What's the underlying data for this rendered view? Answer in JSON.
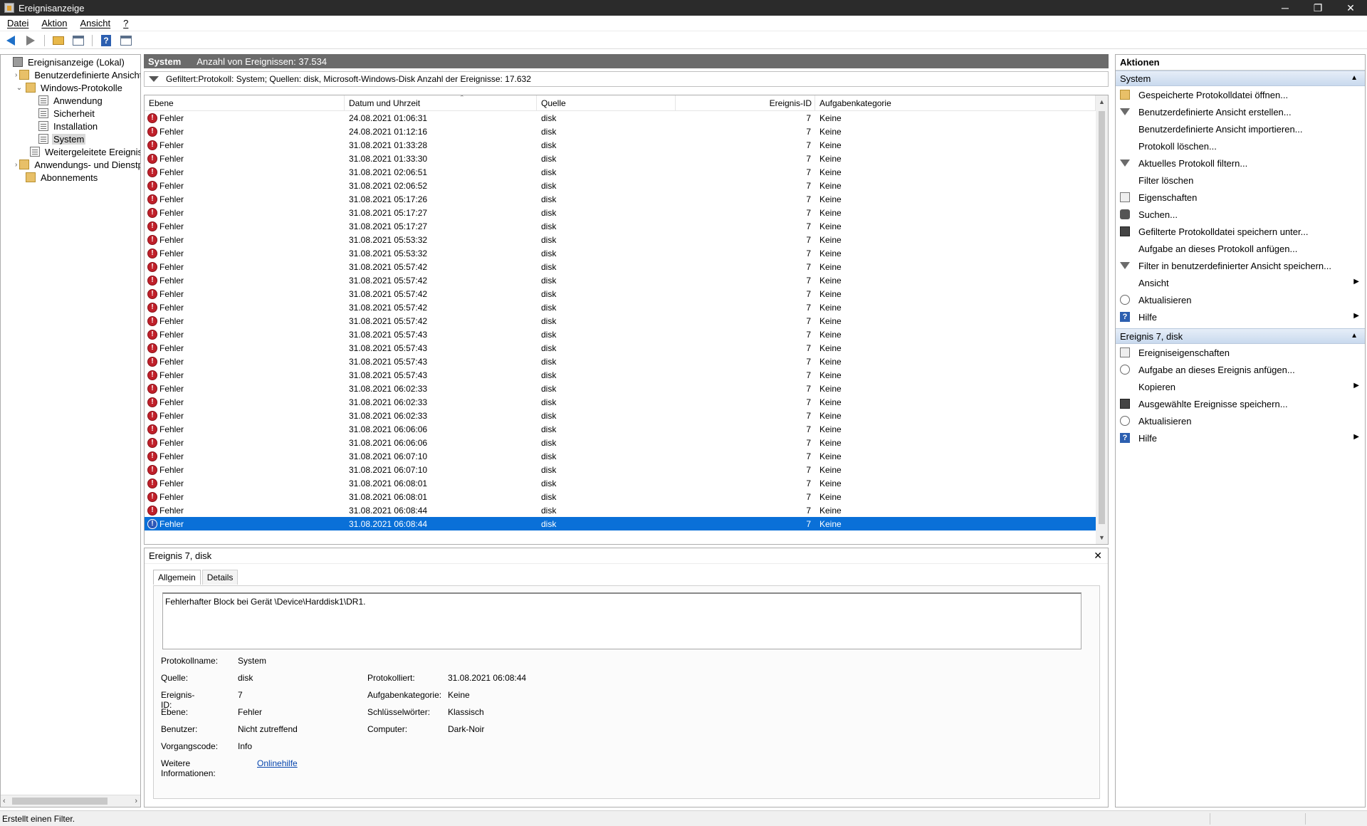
{
  "window": {
    "title": "Ereignisanzeige",
    "controls": {
      "minimize": "─",
      "restore": "❐",
      "close": "✕"
    }
  },
  "menu": [
    "Datei",
    "Aktion",
    "Ansicht",
    "?"
  ],
  "tree": {
    "items": [
      {
        "label": "Ereignisanzeige (Lokal)",
        "icon": "root-icon",
        "level": 0,
        "twisty": ""
      },
      {
        "label": "Benutzerdefinierte Ansichten",
        "icon": "folder-icon",
        "level": 1,
        "twisty": "›"
      },
      {
        "label": "Windows-Protokolle",
        "icon": "folder-icon",
        "level": 1,
        "twisty": "⌄"
      },
      {
        "label": "Anwendung",
        "icon": "log-icon",
        "level": 2,
        "twisty": ""
      },
      {
        "label": "Sicherheit",
        "icon": "log-icon",
        "level": 2,
        "twisty": ""
      },
      {
        "label": "Installation",
        "icon": "log-icon",
        "level": 2,
        "twisty": ""
      },
      {
        "label": "System",
        "icon": "log-icon",
        "level": 2,
        "twisty": "",
        "selected": true
      },
      {
        "label": "Weitergeleitete Ereignisse",
        "icon": "log-icon",
        "level": 2,
        "twisty": ""
      },
      {
        "label": "Anwendungs- und Dienstprotokolle",
        "icon": "folder-icon",
        "level": 1,
        "twisty": "›"
      },
      {
        "label": "Abonnements",
        "icon": "folder-icon",
        "level": 1,
        "twisty": ""
      }
    ]
  },
  "center": {
    "header_title": "System",
    "header_count": "Anzahl von Ereignissen: 37.534",
    "filter_text": "Gefiltert:Protokoll: System; Quellen: disk, Microsoft-Windows-Disk Anzahl der Ereignisse: 17.632",
    "columns": {
      "level": "Ebene",
      "date": "Datum und Uhrzeit",
      "source": "Quelle",
      "id": "Ereignis-ID",
      "category": "Aufgabenkategorie"
    },
    "rows": [
      {
        "level": "Fehler",
        "date": "24.08.2021 01:06:31",
        "source": "disk",
        "id": "7",
        "category": "Keine"
      },
      {
        "level": "Fehler",
        "date": "24.08.2021 01:12:16",
        "source": "disk",
        "id": "7",
        "category": "Keine"
      },
      {
        "level": "Fehler",
        "date": "31.08.2021 01:33:28",
        "source": "disk",
        "id": "7",
        "category": "Keine"
      },
      {
        "level": "Fehler",
        "date": "31.08.2021 01:33:30",
        "source": "disk",
        "id": "7",
        "category": "Keine"
      },
      {
        "level": "Fehler",
        "date": "31.08.2021 02:06:51",
        "source": "disk",
        "id": "7",
        "category": "Keine"
      },
      {
        "level": "Fehler",
        "date": "31.08.2021 02:06:52",
        "source": "disk",
        "id": "7",
        "category": "Keine"
      },
      {
        "level": "Fehler",
        "date": "31.08.2021 05:17:26",
        "source": "disk",
        "id": "7",
        "category": "Keine"
      },
      {
        "level": "Fehler",
        "date": "31.08.2021 05:17:27",
        "source": "disk",
        "id": "7",
        "category": "Keine"
      },
      {
        "level": "Fehler",
        "date": "31.08.2021 05:17:27",
        "source": "disk",
        "id": "7",
        "category": "Keine"
      },
      {
        "level": "Fehler",
        "date": "31.08.2021 05:53:32",
        "source": "disk",
        "id": "7",
        "category": "Keine"
      },
      {
        "level": "Fehler",
        "date": "31.08.2021 05:53:32",
        "source": "disk",
        "id": "7",
        "category": "Keine"
      },
      {
        "level": "Fehler",
        "date": "31.08.2021 05:57:42",
        "source": "disk",
        "id": "7",
        "category": "Keine"
      },
      {
        "level": "Fehler",
        "date": "31.08.2021 05:57:42",
        "source": "disk",
        "id": "7",
        "category": "Keine"
      },
      {
        "level": "Fehler",
        "date": "31.08.2021 05:57:42",
        "source": "disk",
        "id": "7",
        "category": "Keine"
      },
      {
        "level": "Fehler",
        "date": "31.08.2021 05:57:42",
        "source": "disk",
        "id": "7",
        "category": "Keine"
      },
      {
        "level": "Fehler",
        "date": "31.08.2021 05:57:42",
        "source": "disk",
        "id": "7",
        "category": "Keine"
      },
      {
        "level": "Fehler",
        "date": "31.08.2021 05:57:43",
        "source": "disk",
        "id": "7",
        "category": "Keine"
      },
      {
        "level": "Fehler",
        "date": "31.08.2021 05:57:43",
        "source": "disk",
        "id": "7",
        "category": "Keine"
      },
      {
        "level": "Fehler",
        "date": "31.08.2021 05:57:43",
        "source": "disk",
        "id": "7",
        "category": "Keine"
      },
      {
        "level": "Fehler",
        "date": "31.08.2021 05:57:43",
        "source": "disk",
        "id": "7",
        "category": "Keine"
      },
      {
        "level": "Fehler",
        "date": "31.08.2021 06:02:33",
        "source": "disk",
        "id": "7",
        "category": "Keine"
      },
      {
        "level": "Fehler",
        "date": "31.08.2021 06:02:33",
        "source": "disk",
        "id": "7",
        "category": "Keine"
      },
      {
        "level": "Fehler",
        "date": "31.08.2021 06:02:33",
        "source": "disk",
        "id": "7",
        "category": "Keine"
      },
      {
        "level": "Fehler",
        "date": "31.08.2021 06:06:06",
        "source": "disk",
        "id": "7",
        "category": "Keine"
      },
      {
        "level": "Fehler",
        "date": "31.08.2021 06:06:06",
        "source": "disk",
        "id": "7",
        "category": "Keine"
      },
      {
        "level": "Fehler",
        "date": "31.08.2021 06:07:10",
        "source": "disk",
        "id": "7",
        "category": "Keine"
      },
      {
        "level": "Fehler",
        "date": "31.08.2021 06:07:10",
        "source": "disk",
        "id": "7",
        "category": "Keine"
      },
      {
        "level": "Fehler",
        "date": "31.08.2021 06:08:01",
        "source": "disk",
        "id": "7",
        "category": "Keine"
      },
      {
        "level": "Fehler",
        "date": "31.08.2021 06:08:01",
        "source": "disk",
        "id": "7",
        "category": "Keine"
      },
      {
        "level": "Fehler",
        "date": "31.08.2021 06:08:44",
        "source": "disk",
        "id": "7",
        "category": "Keine"
      },
      {
        "level": "Fehler",
        "date": "31.08.2021 06:08:44",
        "source": "disk",
        "id": "7",
        "category": "Keine",
        "selected": true
      }
    ],
    "colors": {
      "selection": "#0a70d8",
      "error": "#c0202a",
      "header": "#6b6b6b"
    }
  },
  "detail": {
    "title": "Ereignis 7, disk",
    "close": "✕",
    "tabs": [
      "Allgemein",
      "Details"
    ],
    "description": "Fehlerhafter Block bei Gerät \\Device\\Harddisk1\\DR1.",
    "labels": {
      "log_name": "Protokollname:",
      "source": "Quelle:",
      "event_id": "Ereignis-ID:",
      "level": "Ebene:",
      "user": "Benutzer:",
      "opcode": "Vorgangscode:",
      "more_info": "Weitere Informationen:",
      "logged": "Protokolliert:",
      "task_category": "Aufgabenkategorie:",
      "keywords": "Schlüsselwörter:",
      "computer": "Computer:"
    },
    "values": {
      "log_name": "System",
      "source": "disk",
      "event_id": "7",
      "level": "Fehler",
      "user": "Nicht zutreffend",
      "opcode": "Info",
      "more_info": "Onlinehilfe",
      "logged": "31.08.2021 06:08:44",
      "task_category": "Keine",
      "keywords": "Klassisch",
      "computer": "Dark-Noir"
    }
  },
  "actions": {
    "title": "Aktionen",
    "section1": "System",
    "items1": [
      {
        "label": "Gespeicherte Protokolldatei öffnen...",
        "icon": "open-icon"
      },
      {
        "label": "Benutzerdefinierte Ansicht erstellen...",
        "icon": "filter-icon"
      },
      {
        "label": "Benutzerdefinierte Ansicht importieren...",
        "icon": "blank"
      },
      {
        "label": "Protokoll löschen...",
        "icon": "blank"
      },
      {
        "label": "Aktuelles Protokoll filtern...",
        "icon": "filter-icon"
      },
      {
        "label": "Filter löschen",
        "icon": "blank"
      },
      {
        "label": "Eigenschaften",
        "icon": "properties-icon"
      },
      {
        "label": "Suchen...",
        "icon": "find-icon"
      },
      {
        "label": "Gefilterte Protokolldatei speichern unter...",
        "icon": "save-icon"
      },
      {
        "label": "Aufgabe an dieses Protokoll anfügen...",
        "icon": "blank"
      },
      {
        "label": "Filter in benutzerdefinierter Ansicht speichern...",
        "icon": "filter-icon"
      },
      {
        "label": "Ansicht",
        "icon": "blank",
        "submenu": true
      },
      {
        "label": "Aktualisieren",
        "icon": "refresh-icon"
      },
      {
        "label": "Hilfe",
        "icon": "help-icon",
        "submenu": true
      }
    ],
    "section2": "Ereignis 7, disk",
    "items2": [
      {
        "label": "Ereigniseigenschaften",
        "icon": "properties-icon"
      },
      {
        "label": "Aufgabe an dieses Ereignis anfügen...",
        "icon": "task-icon"
      },
      {
        "label": "Kopieren",
        "icon": "blank",
        "submenu": true
      },
      {
        "label": "Ausgewählte Ereignisse speichern...",
        "icon": "save-icon"
      },
      {
        "label": "Aktualisieren",
        "icon": "refresh-icon"
      },
      {
        "label": "Hilfe",
        "icon": "help-icon",
        "submenu": true
      }
    ]
  },
  "status": {
    "text": "Erstellt einen Filter."
  }
}
